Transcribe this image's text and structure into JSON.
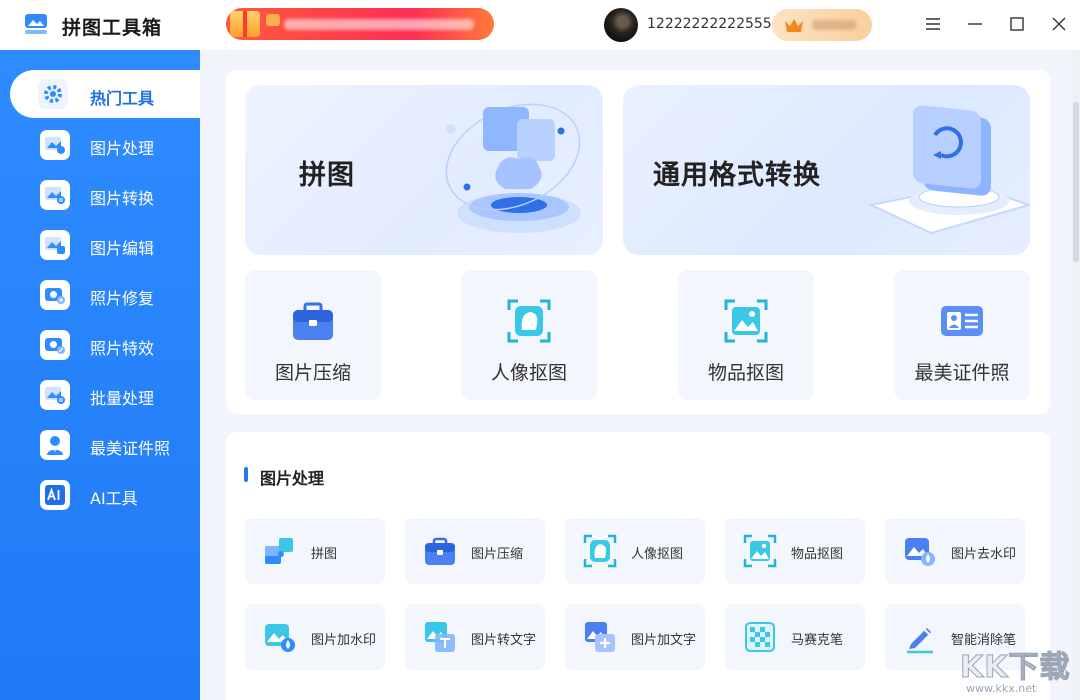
{
  "app": {
    "title": "拼图工具箱"
  },
  "header": {
    "phone": "12222222222555",
    "window_controls": [
      "menu-icon",
      "minimize-icon",
      "maximize-icon",
      "close-icon"
    ]
  },
  "sidebar": {
    "items": [
      {
        "label": "热门工具",
        "icon": "settings-gear-icon",
        "active": true
      },
      {
        "label": "图片处理",
        "icon": "image-process-icon"
      },
      {
        "label": "图片转换",
        "icon": "image-convert-icon"
      },
      {
        "label": "图片编辑",
        "icon": "image-edit-icon"
      },
      {
        "label": "照片修复",
        "icon": "photo-repair-icon"
      },
      {
        "label": "照片特效",
        "icon": "photo-effect-icon"
      },
      {
        "label": "批量处理",
        "icon": "batch-icon"
      },
      {
        "label": "最美证件照",
        "icon": "id-photo-icon"
      },
      {
        "label": "AI工具",
        "icon": "ai-icon"
      }
    ]
  },
  "hot": {
    "banners": [
      {
        "label": "拼图"
      },
      {
        "label": "通用格式转换"
      }
    ],
    "tiles": [
      {
        "label": "图片压缩",
        "icon": "briefcase-icon"
      },
      {
        "label": "人像抠图",
        "icon": "portrait-cutout-icon"
      },
      {
        "label": "物品抠图",
        "icon": "object-cutout-icon"
      },
      {
        "label": "最美证件照",
        "icon": "id-card-icon"
      }
    ]
  },
  "image_processing": {
    "title": "图片处理",
    "tools": [
      {
        "label": "拼图",
        "icon": "puzzle-icon"
      },
      {
        "label": "图片压缩",
        "icon": "briefcase-icon"
      },
      {
        "label": "人像抠图",
        "icon": "portrait-cutout-icon"
      },
      {
        "label": "物品抠图",
        "icon": "object-cutout-icon"
      },
      {
        "label": "图片去水印",
        "icon": "remove-watermark-icon"
      },
      {
        "label": "图片加水印",
        "icon": "add-watermark-icon"
      },
      {
        "label": "图片转文字",
        "icon": "image-to-text-icon"
      },
      {
        "label": "图片加文字",
        "icon": "add-text-icon"
      },
      {
        "label": "马赛克笔",
        "icon": "mosaic-icon"
      },
      {
        "label": "智能消除笔",
        "icon": "eraser-pen-icon"
      }
    ]
  },
  "watermark": {
    "big": "KK下载",
    "small": "www.kkx.net"
  },
  "colors": {
    "primary": "#1f7af6",
    "sidebar": "#2f8cff",
    "tile_bg": "#f3f6fc"
  }
}
